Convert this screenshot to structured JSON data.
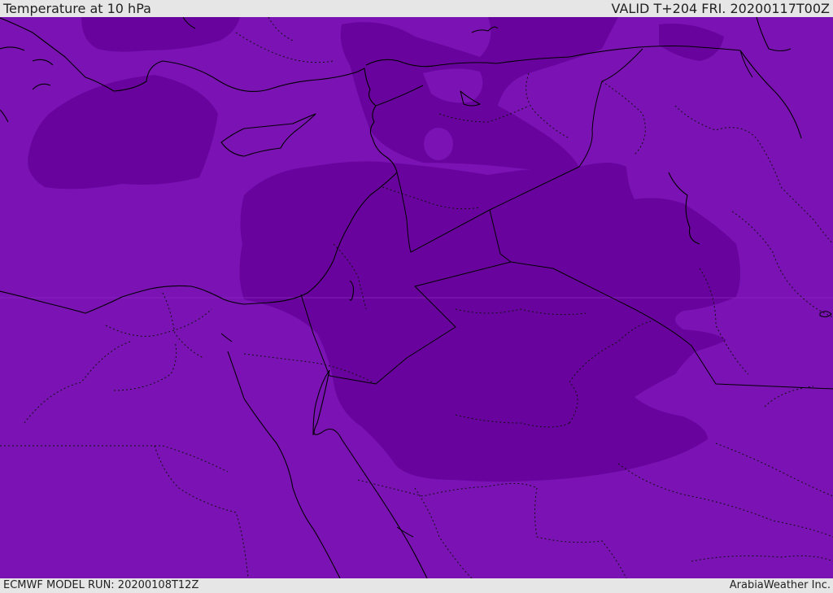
{
  "header": {
    "title": "Temperature at 10 hPa",
    "valid": "VALID T+204 FRI. 20200117T00Z"
  },
  "footer": {
    "model_run": "ECMWF MODEL RUN: 20200108T12Z",
    "credit": "ArabiaWeather Inc."
  },
  "colors": {
    "background_fill": "#7a12b4",
    "cold_fill": "#68049d",
    "border_line": "#000000",
    "bar": "#e6e6e6"
  },
  "map": {
    "region": "Middle East / Eastern Mediterranean",
    "layers": [
      "coastlines",
      "country-borders",
      "province-borders",
      "temperature-contour-fill"
    ]
  }
}
